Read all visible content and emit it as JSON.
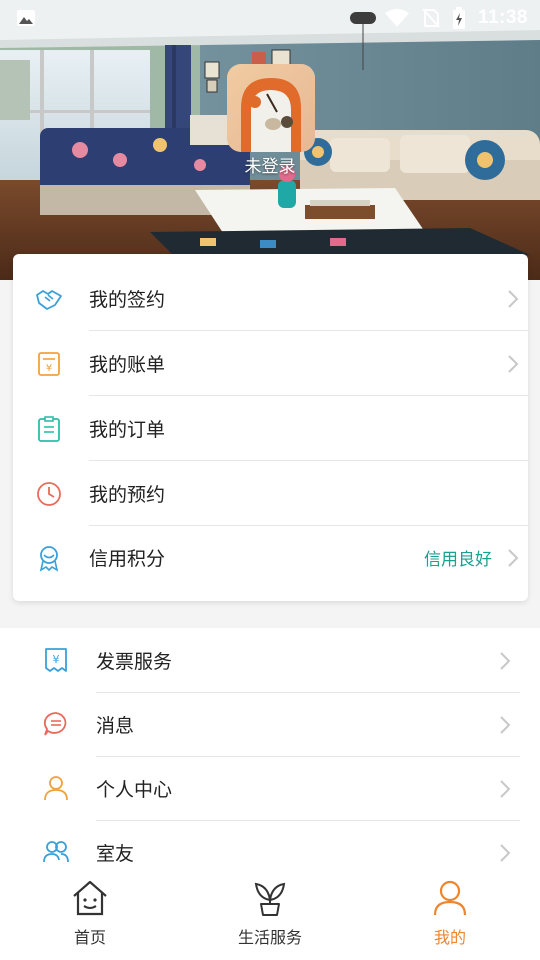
{
  "status_bar": {
    "time": "11:38"
  },
  "profile": {
    "login_text": "未登录"
  },
  "card_menu": [
    {
      "label": "我的签约",
      "icon": "handshake-icon",
      "has_chevron": true
    },
    {
      "label": "我的账单",
      "icon": "bill-icon",
      "has_chevron": true
    },
    {
      "label": "我的订单",
      "icon": "clipboard-icon",
      "has_chevron": false
    },
    {
      "label": "我的预约",
      "icon": "clock-icon",
      "has_chevron": false
    },
    {
      "label": "信用积分",
      "icon": "award-icon",
      "has_chevron": true,
      "status": "信用良好"
    }
  ],
  "menu2": [
    {
      "label": "发票服务",
      "icon": "invoice-icon"
    },
    {
      "label": "消息",
      "icon": "message-icon"
    },
    {
      "label": "个人中心",
      "icon": "user-icon"
    },
    {
      "label": "室友",
      "icon": "roommates-icon"
    }
  ],
  "bottom_nav": [
    {
      "label": "首页",
      "icon": "house-icon",
      "active": false
    },
    {
      "label": "生活服务",
      "icon": "plant-icon",
      "active": false
    },
    {
      "label": "我的",
      "icon": "person-icon",
      "active": true
    }
  ],
  "colors": {
    "accent_orange": "#f0852c",
    "credit_green": "#1aa190",
    "icon_blue": "#3aa0d8",
    "icon_orange": "#f0a23c",
    "icon_teal": "#2bbfa8",
    "icon_red": "#e96a5c"
  }
}
